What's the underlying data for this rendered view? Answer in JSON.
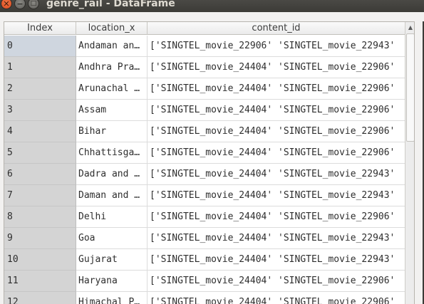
{
  "window": {
    "title": "genre_rail - DataFrame",
    "close_glyph": "✕",
    "minimize_glyph": "−",
    "maximize_glyph": "□"
  },
  "table": {
    "columns": [
      "Index",
      "location_x",
      "content_id"
    ],
    "rows": [
      {
        "index": "0",
        "location_x": "Andaman an…",
        "content_id": "['SINGTEL_movie_22906' 'SINGTEL_movie_22943'"
      },
      {
        "index": "1",
        "location_x": "Andhra Pra…",
        "content_id": "['SINGTEL_movie_24404' 'SINGTEL_movie_22906'"
      },
      {
        "index": "2",
        "location_x": "Arunachal …",
        "content_id": "['SINGTEL_movie_24404' 'SINGTEL_movie_22906'"
      },
      {
        "index": "3",
        "location_x": "Assam",
        "content_id": "['SINGTEL_movie_24404' 'SINGTEL_movie_22906'"
      },
      {
        "index": "4",
        "location_x": "Bihar",
        "content_id": "['SINGTEL_movie_24404' 'SINGTEL_movie_22906'"
      },
      {
        "index": "5",
        "location_x": "Chhattisga…",
        "content_id": "['SINGTEL_movie_24404' 'SINGTEL_movie_22906'"
      },
      {
        "index": "6",
        "location_x": "Dadra and …",
        "content_id": "['SINGTEL_movie_24404' 'SINGTEL_movie_22943'"
      },
      {
        "index": "7",
        "location_x": "Daman and …",
        "content_id": "['SINGTEL_movie_24404' 'SINGTEL_movie_22943'"
      },
      {
        "index": "8",
        "location_x": "Delhi",
        "content_id": "['SINGTEL_movie_24404' 'SINGTEL_movie_22906'"
      },
      {
        "index": "9",
        "location_x": "Goa",
        "content_id": "['SINGTEL_movie_24404' 'SINGTEL_movie_22943'"
      },
      {
        "index": "10",
        "location_x": "Gujarat",
        "content_id": "['SINGTEL_movie_24404' 'SINGTEL_movie_22943'"
      },
      {
        "index": "11",
        "location_x": "Haryana",
        "content_id": "['SINGTEL_movie_24404' 'SINGTEL_movie_22906'"
      },
      {
        "index": "12",
        "location_x": "Himachal P…",
        "content_id": "['SINGTEL_movie_24404' 'SINGTEL_movie_22906'"
      }
    ],
    "selected_row": 0
  },
  "scrollbar": {
    "up_glyph": "▲",
    "position_fraction": 0.0
  }
}
